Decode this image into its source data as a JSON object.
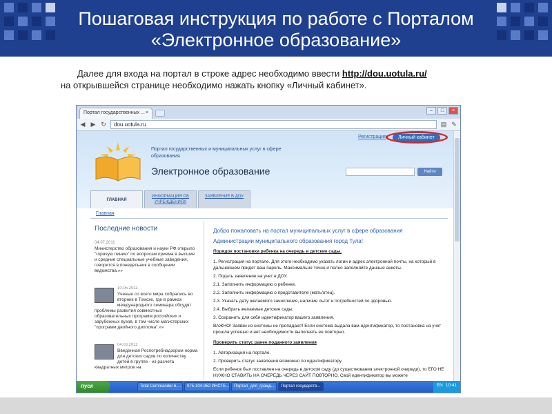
{
  "slide": {
    "title_line1": "Пошаговая инструкция по работе с Порталом",
    "title_line2": "«Электронное образование»",
    "instruction_prefix": "Далее для входа на портал в строке адрес необходимо ввести ",
    "instruction_url": "http://dou.uotula.ru/",
    "instruction_suffix": "на открывшейся странице необходимо нажать кнопку «Личный кабинет».",
    "colors": {
      "header_bg": "#1f3f8f",
      "highlight_oval": "#d42a2a"
    }
  },
  "browser": {
    "tab_title": "Портал государственных ...",
    "tab_close": "×",
    "address": "dou.uotula.ru",
    "icons": [
      "back-icon",
      "forward-icon",
      "reload-icon",
      "page-icon",
      "wrench-icon"
    ]
  },
  "site": {
    "register_link": "Регистрация",
    "cabinet_button": "Личный кабинет",
    "portal_subtitle": "Портал государственных и муниципальных услуг в сфере образования",
    "site_name": "Электронное образование",
    "search_button": "Найти",
    "tabs": [
      {
        "label": "ГЛАВНАЯ"
      },
      {
        "label": "ИНФОРМАЦИЯ ОБ УЧРЕЖДЕНИЯХ"
      },
      {
        "label": "ЗАЯВЛЕНИЕ В ДОУ"
      }
    ],
    "breadcrumb": "Главная",
    "news_heading": "Последние новости",
    "news": [
      {
        "date": "04.07.2011",
        "text": "Министерство образования и науки РФ открыло \"горячую линию\" по вопросам приема в высшие и средние специальные учебные заведения, говорится в понедельник в сообщении ведомства.»»"
      },
      {
        "date": "10.05.2011",
        "text": "Ученые со всего мира собрались во вторник в Томске, где в рамках международного семинара обсудят проблемы развития совместных образовательных программ российских и зарубежных вузов, в том числе магистерских \"программ двойного диплома\".»»"
      },
      {
        "date": "04.03.2011",
        "text": "Введенная Роспотребнадзором норма для детских садов по количеству детей в группе - из расчета квадратных метров на"
      }
    ],
    "welcome": "Добро пожаловать на портал муниципальных услуг в сфере образования",
    "admin": "Администрации муниципального образования город Тула!",
    "order_heading": "Порядок постановки ребенка на очередь в детские сады.",
    "steps": [
      "1. Регистрация на портале. Для этого необходимо указать логин и адрес электронной почты, на который в дальнейшем придет ваш пароль. Максимально точно и полно заполняйте данные анкеты.",
      "2. Подать заявление на учет в ДОУ.",
      "2.1. Заполнить информацию о ребенке.",
      "2.2. Заполнить информацию о представителе (мать/отец).",
      "2.3. Указать дату желаемого зачисления, наличие льгот и потребностей по здоровью.",
      "2.4. Выбрать желаемые детские сады.",
      "3. Сохранить для себя идентификатор вашего заявления.",
      "ВАЖНО! Заявки из системы не пропадают! Если система выдала вам идентификатор, то постановка на учет прошла успешно и нет необходимости выполнять ее повторно."
    ],
    "status_heading": "Проверить статус ранее поданного заявления",
    "status_steps": [
      "1. Авторизация на портале.",
      "2. Проверить статус заявления возможно по идентификатору.",
      "Если ребенок был поставлен на очередь в детском саду (до существования электронной очереди), то ЕГО НЕ НУЖНО СТАВИТЬ НА ОЧЕРЕДЬ ЧЕРЕЗ САЙТ ПОВТОРНО. Свой идентификатор вы можете"
    ]
  },
  "taskbar": {
    "start": "пуск",
    "buttons": [
      "Total Commander 6....",
      "075-104-952 ИНСТЕ...",
      "Портал_для_гражд...",
      "Портал государств..."
    ],
    "lang": "EN",
    "time": "10:41"
  }
}
